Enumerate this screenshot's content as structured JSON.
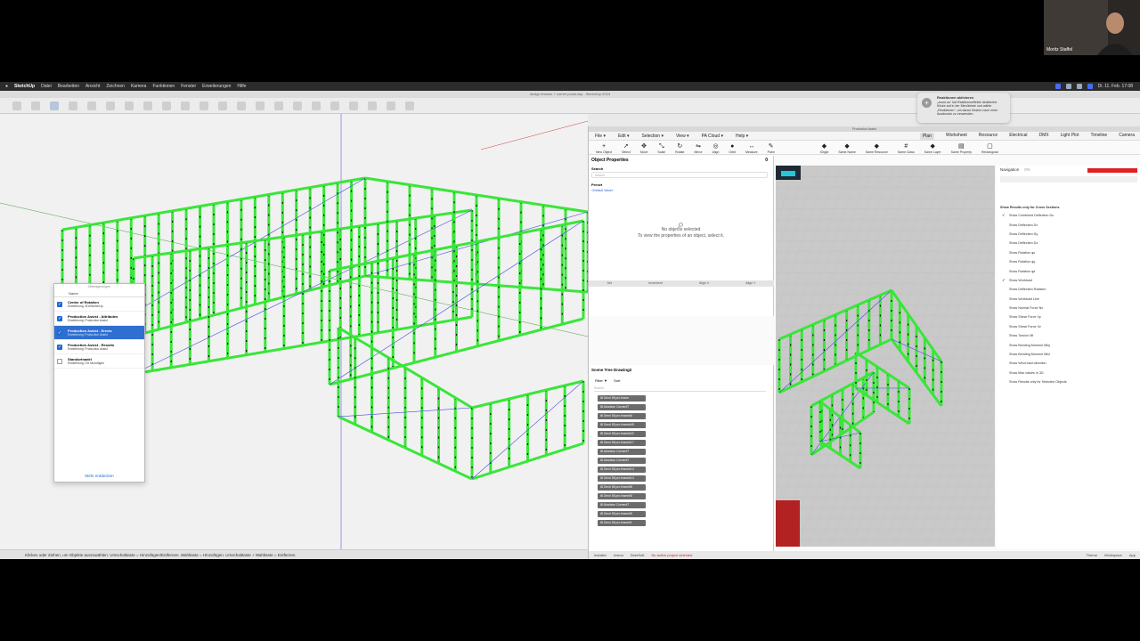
{
  "menubar": {
    "app": "SketchUp",
    "items": [
      "Datei",
      "Bearbeiten",
      "Ansicht",
      "Zeichnen",
      "Kamera",
      "Funktionen",
      "Fenster",
      "Erweiterungen",
      "Hilfe"
    ],
    "clock": "Di. 11. Feb. 17:08"
  },
  "sketchup": {
    "window_title": "design-frames + corner posts.skp - SketchUp 2024",
    "status_text": "Klicken oder Ziehen, um Objekte auszuwählen. Umschalttaste = Hinzufügen/Entfernen. Wahltaste = Hinzufügen. Umschalttaste + Wahltaste = Entfernen."
  },
  "ext_dialog": {
    "title": "Überlagerungen",
    "header": "Name",
    "items": [
      {
        "name": "Center of Rotation",
        "sub": "Erweiterung: 3DxSketchUp",
        "checked": true,
        "selected": false
      },
      {
        "name": "Production Assist - Attributes",
        "sub": "Erweiterung: Production Assist",
        "checked": true,
        "selected": false
      },
      {
        "name": "Production Assist - Errors",
        "sub": "Erweiterung: Production Assist",
        "checked": true,
        "selected": true
      },
      {
        "name": "Production Assist - Results",
        "sub": "Erweiterung: Production Assist",
        "checked": true,
        "selected": false
      },
      {
        "name": "Standortnadel",
        "sub": "Erweiterung: Ort hinzufügen",
        "checked": false,
        "selected": false
      }
    ],
    "more_link": "Mehr entdecken"
  },
  "notification": {
    "title": "Reaktionen aktivieren",
    "body": "„zoom.us“ hat Reaktionseffekte deaktiviert. Klicke auf  in der Menüleiste und wähle „Reaktionen“, um daran Gesten nach mehr Ausdrucke zu verwenden."
  },
  "webcam": {
    "name": "Moritz Staffel"
  },
  "pa": {
    "window_title": "Production Assist",
    "menu": [
      "File",
      "Edit",
      "Selection",
      "View",
      "PA Cloud",
      "Help"
    ],
    "tabs": [
      "Plan",
      "Worksheet",
      "Resource",
      "Electrical",
      "DMX",
      "Light Plot",
      "Timeline",
      "Camera"
    ],
    "active_tab": "Plan",
    "tools": [
      {
        "icon": "+",
        "label": "New Object"
      },
      {
        "icon": "➚",
        "label": "Select"
      },
      {
        "icon": "✥",
        "label": "Move"
      },
      {
        "icon": "⤡",
        "label": "Scale"
      },
      {
        "icon": "↻",
        "label": "Rotate"
      },
      {
        "icon": "⇋",
        "label": "Mirror"
      },
      {
        "icon": "◎",
        "label": "Align"
      },
      {
        "icon": "●",
        "label": "Orbit"
      },
      {
        "icon": "↔",
        "label": "Measure"
      },
      {
        "icon": "✎",
        "label": "Paint"
      }
    ],
    "right_tools": [
      {
        "icon": "◆",
        "label": "Single"
      },
      {
        "icon": "◆",
        "label": "Same Name"
      },
      {
        "icon": "◆",
        "label": "Same Resource"
      },
      {
        "icon": "#",
        "label": "Same Class"
      },
      {
        "icon": "◆",
        "label": "Same Layer"
      },
      {
        "icon": "▤",
        "label": "Same Property"
      },
      {
        "icon": "▢",
        "label": "Rectangular"
      }
    ],
    "object_properties": {
      "title": "Object Properties",
      "count": "0",
      "search_label": "Search",
      "search_placeholder": "Search",
      "preset_label": "Preset",
      "preset_value": "<Default Value>",
      "empty_title": "No objects selected",
      "empty_body": "To view the properties of an object, select it.",
      "tabs": [
        "Set",
        "Increment",
        "Align X",
        "Align Y"
      ]
    },
    "scene_tree": {
      "title": "Scene Tree Drawing2",
      "filter": "Filter",
      "sort": "Sort",
      "search_placeholder": "Search",
      "items": [
        "Omni 55 pro frame",
        "Aluvision Corner#7",
        "Omni 55 pro frame#6",
        "Omni 55 pro frame#49",
        "Omni 55 pro frame#22",
        "Omni 55 pro frame#17",
        "Aluvision Corner#7",
        "Aluvision Corner#7",
        "Omni 55 pro frame#14",
        "Omni 55 pro frame#13",
        "Omni 55 pro frame#8",
        "Omni 55 pro frame#5",
        "Aluvision Corner#7",
        "Omni 55 pro frame#5",
        "Omni 55 pro frame#1"
      ]
    },
    "navigation": {
      "title": "Navigation",
      "zoom": "0%",
      "cross_section_label": "Show Results only for Cross Sections",
      "options": [
        {
          "label": "Show Combined Deflection Du",
          "checked": true
        },
        {
          "label": "Show Deflection Dx",
          "checked": false
        },
        {
          "label": "Show Deflection Dy",
          "checked": false
        },
        {
          "label": "Show Deflection Dz",
          "checked": false
        },
        {
          "label": "Show Rotation φx",
          "checked": false
        },
        {
          "label": "Show Rotation φy",
          "checked": false
        },
        {
          "label": "Show Rotation φz",
          "checked": false
        },
        {
          "label": "Show Workload",
          "checked": true
        },
        {
          "label": "Show Deflection Rotation",
          "checked": false
        },
        {
          "label": "Show Workload Line",
          "checked": false
        },
        {
          "label": "Show Normal Force Nx",
          "checked": false
        },
        {
          "label": "Show Shear Force Vy",
          "checked": false
        },
        {
          "label": "Show Shear Force Vz",
          "checked": false
        },
        {
          "label": "Show Torsion Mt",
          "checked": false
        },
        {
          "label": "Show Bending Moment Mby",
          "checked": false
        },
        {
          "label": "Show Bending Moment Mbz",
          "checked": false
        },
        {
          "label": "Show Wind load direction",
          "checked": false
        },
        {
          "label": "Show Max values in 3D",
          "checked": false
        },
        {
          "label": "Show Results only for Selected Objects",
          "checked": false
        }
      ]
    },
    "status": {
      "items": [
        "Installer",
        "Arena",
        "DeerSoft"
      ],
      "error": "No active project selected",
      "theme": "Theme",
      "workspace": "Workspace",
      "app": "App"
    }
  },
  "colors": {
    "frame_green": "#39e639",
    "selection_blue": "#2f6fd1",
    "chip_gray": "#6b6b6b"
  }
}
